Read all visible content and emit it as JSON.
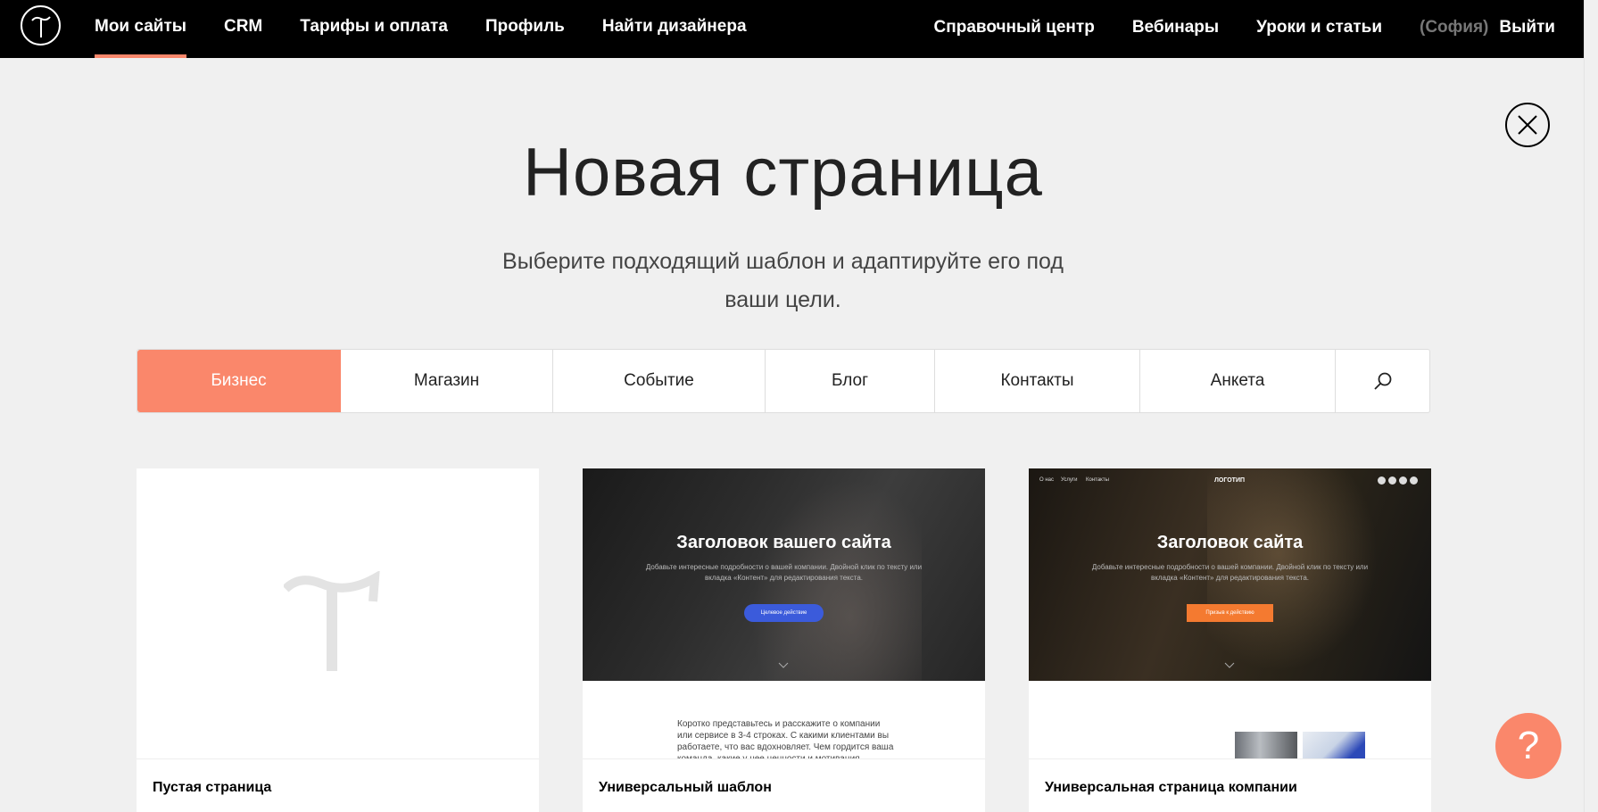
{
  "topbar": {
    "nav_left": [
      {
        "label": "Мои сайты",
        "active": true
      },
      {
        "label": "CRM",
        "active": false
      },
      {
        "label": "Тарифы и оплата",
        "active": false
      },
      {
        "label": "Профиль",
        "active": false
      },
      {
        "label": "Найти дизайнера",
        "active": false
      }
    ],
    "nav_right": [
      {
        "label": "Справочный центр"
      },
      {
        "label": "Вебинары"
      },
      {
        "label": "Уроки и статьи"
      }
    ],
    "user_name": "(София)",
    "logout_label": "Выйти"
  },
  "page": {
    "title": "Новая страница",
    "subtitle": "Выберите подходящий шаблон и адаптируйте его под ваши цели."
  },
  "tabs": [
    {
      "label": "Бизнес",
      "active": true
    },
    {
      "label": "Магазин",
      "active": false
    },
    {
      "label": "Событие",
      "active": false
    },
    {
      "label": "Блог",
      "active": false
    },
    {
      "label": "Контакты",
      "active": false
    },
    {
      "label": "Анкета",
      "active": false
    }
  ],
  "cards": [
    {
      "label": "Пустая страница"
    },
    {
      "label": "Универсальный шаблон",
      "hero_title": "Заголовок вашего сайта",
      "hero_text": "Добавьте интересные подробности о вашей компании. Двойной клик по тексту или вкладка «Контент» для редактирования текста.",
      "hero_button": "Целевое действие",
      "body_text": "Коротко представьтесь и расскажите о компании или сервисе в 3-4 строках. С какими клиентами вы работаете, что вас вдохновляет. Чем гордится ваша команда, какие у нее ценности и мотивация."
    },
    {
      "label": "Универсальная страница компании",
      "hero_title": "Заголовок сайта",
      "hero_text": "Добавьте интересные подробности о вашей компании. Двойной клик по тексту или вкладка «Контент» для редактирования текста.",
      "hero_button": "Призыв к действию",
      "hero_logo": "ЛОГОТИП",
      "hero_nav": [
        "О нас",
        "Услуги",
        "Контакты"
      ]
    }
  ],
  "help_label": "?",
  "colors": {
    "accent": "#fa876b",
    "topbar": "#000000",
    "background": "#f0f0f0",
    "blue_button": "#3b5bdb",
    "orange_button": "#f47a30"
  },
  "icons": {
    "logo": "tilda-logo-icon",
    "close": "close-icon",
    "search": "search-icon",
    "help": "help-icon"
  }
}
